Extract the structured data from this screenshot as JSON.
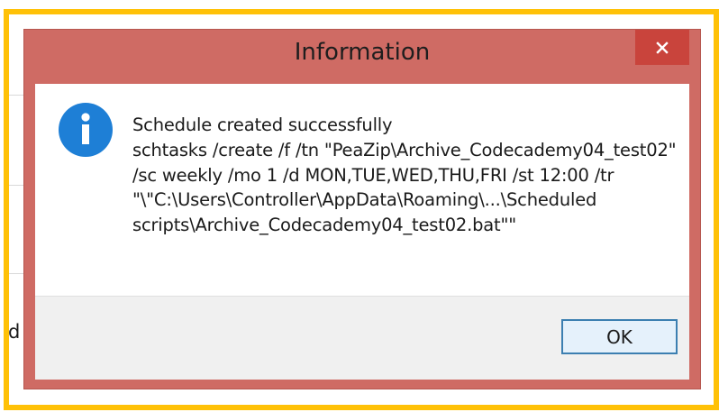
{
  "dialog": {
    "title": "Information",
    "close_label": "✕",
    "icon": "info-icon",
    "message": "Schedule created successfully\nschtasks /create /f /tn \"PeaZip\\Archive_Codecademy04_test02\" /sc weekly /mo 1 /d MON,TUE,WED,THU,FRI /st 12:00 /tr \"\\\"C:\\Users\\Controller\\AppData\\Roaming\\...\\Scheduled scripts\\Archive_Codecademy04_test02.bat\"\"",
    "ok_label": "OK"
  },
  "background": {
    "partial_text": "d"
  },
  "colors": {
    "highlight": "#ffc107",
    "dialog_frame": "#cf6b64",
    "close_button": "#c9443c",
    "icon_blue": "#1e7fd6",
    "ok_border": "#3c7fb1"
  }
}
